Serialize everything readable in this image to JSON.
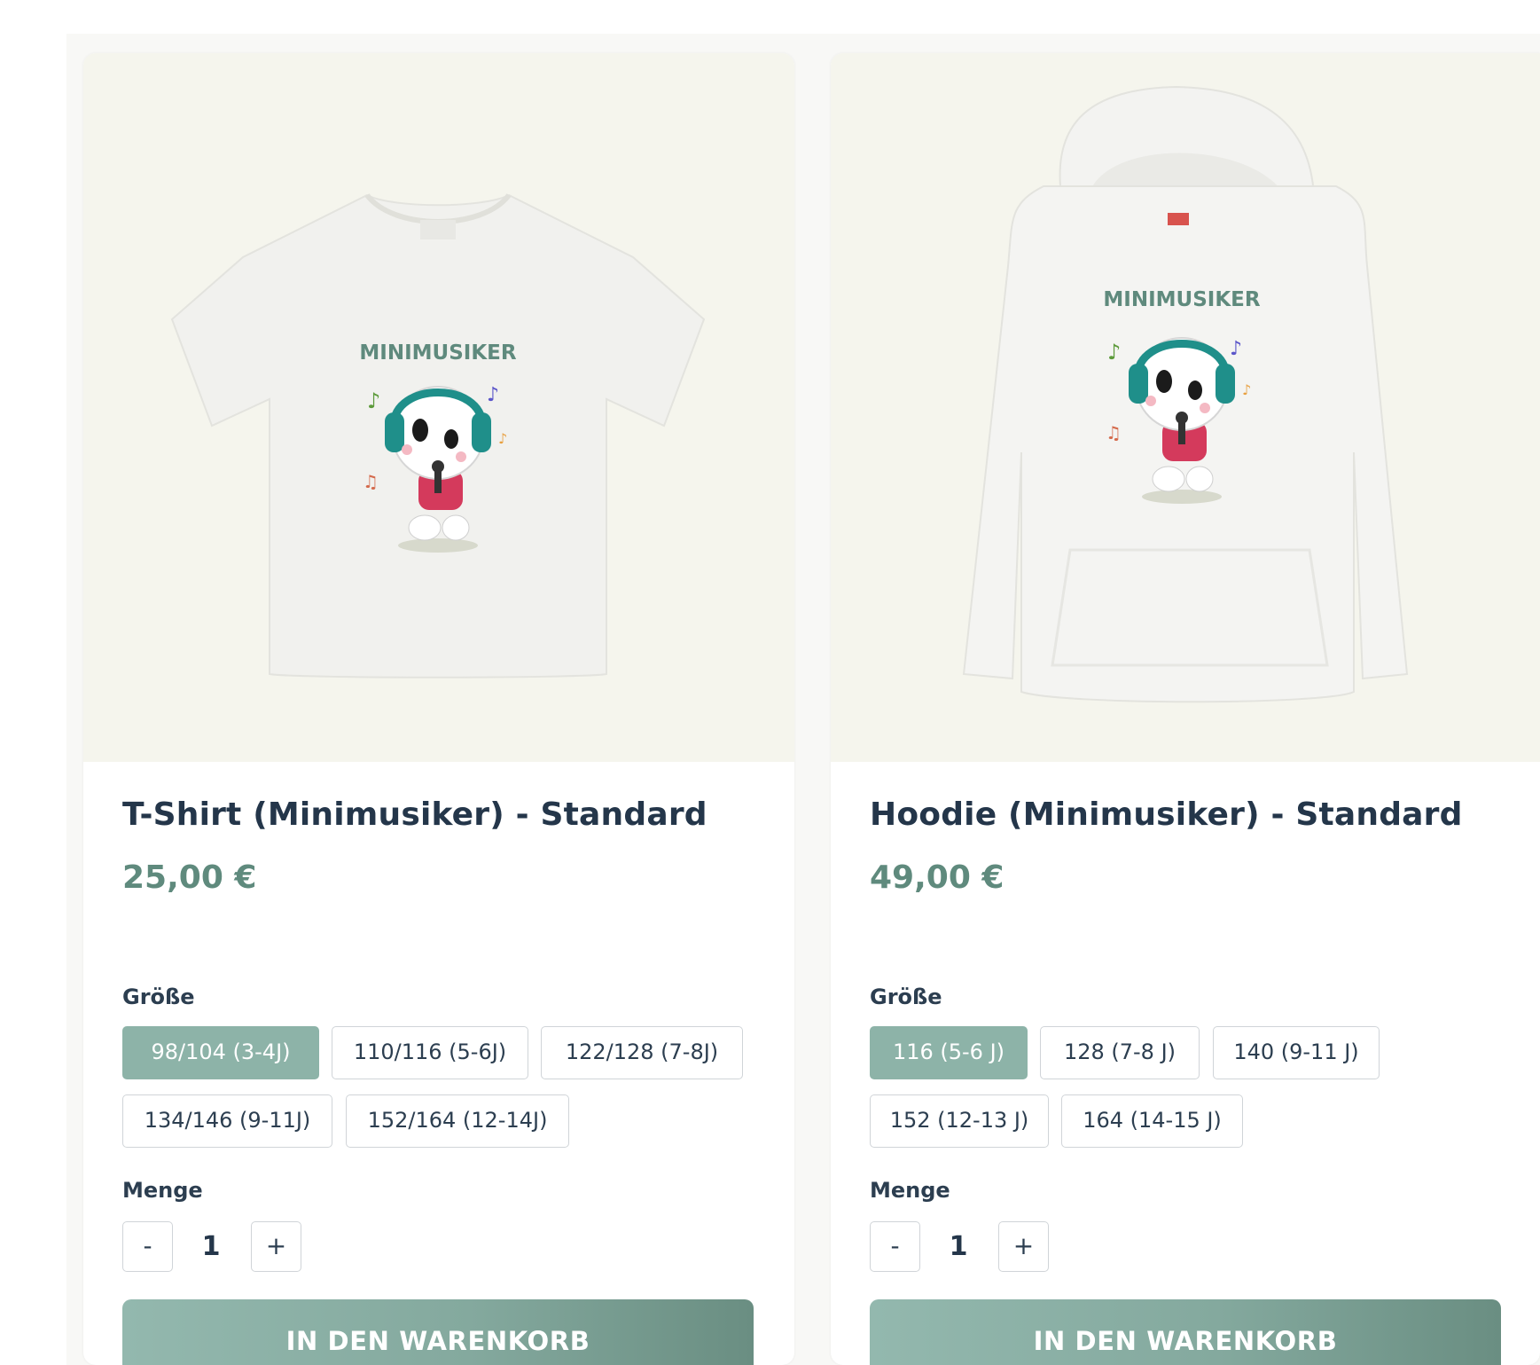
{
  "products": [
    {
      "title": "T-Shirt (Minimusiker) - Standard",
      "price": "25,00 €",
      "print_text": "MINIMUSIKER",
      "size_label": "Größe",
      "sizes": [
        "98/104 (3-4J)",
        "110/116 (5-6J)",
        "122/128 (7-8J)",
        "134/146 (9-11J)",
        "152/164 (12-14J)"
      ],
      "selected_size": "98/104 (3-4J)",
      "quantity_label": "Menge",
      "quantity": "1",
      "minus": "-",
      "plus": "+",
      "cart_button": "IN DEN WARENKORB"
    },
    {
      "title": "Hoodie (Minimusiker) - Standard",
      "price": "49,00 €",
      "print_text": "MINIMUSIKER",
      "size_label": "Größe",
      "sizes": [
        "116 (5-6 J)",
        "128 (7-8 J)",
        "140 (9-11 J)",
        "152 (12-13 J)",
        "164 (14-15 J)"
      ],
      "selected_size": "116 (5-6 J)",
      "quantity_label": "Menge",
      "quantity": "1",
      "minus": "-",
      "plus": "+",
      "cart_button": "IN DEN WARENKORB"
    }
  ],
  "colors": {
    "accent": "#8db3a8",
    "price": "#5f8a7d",
    "title": "#24364a",
    "image_bg": "#f5f5ed",
    "print_green": "#5f8a7d",
    "headphones": "#1f8f8a",
    "character_shirt": "#d43a5c"
  }
}
